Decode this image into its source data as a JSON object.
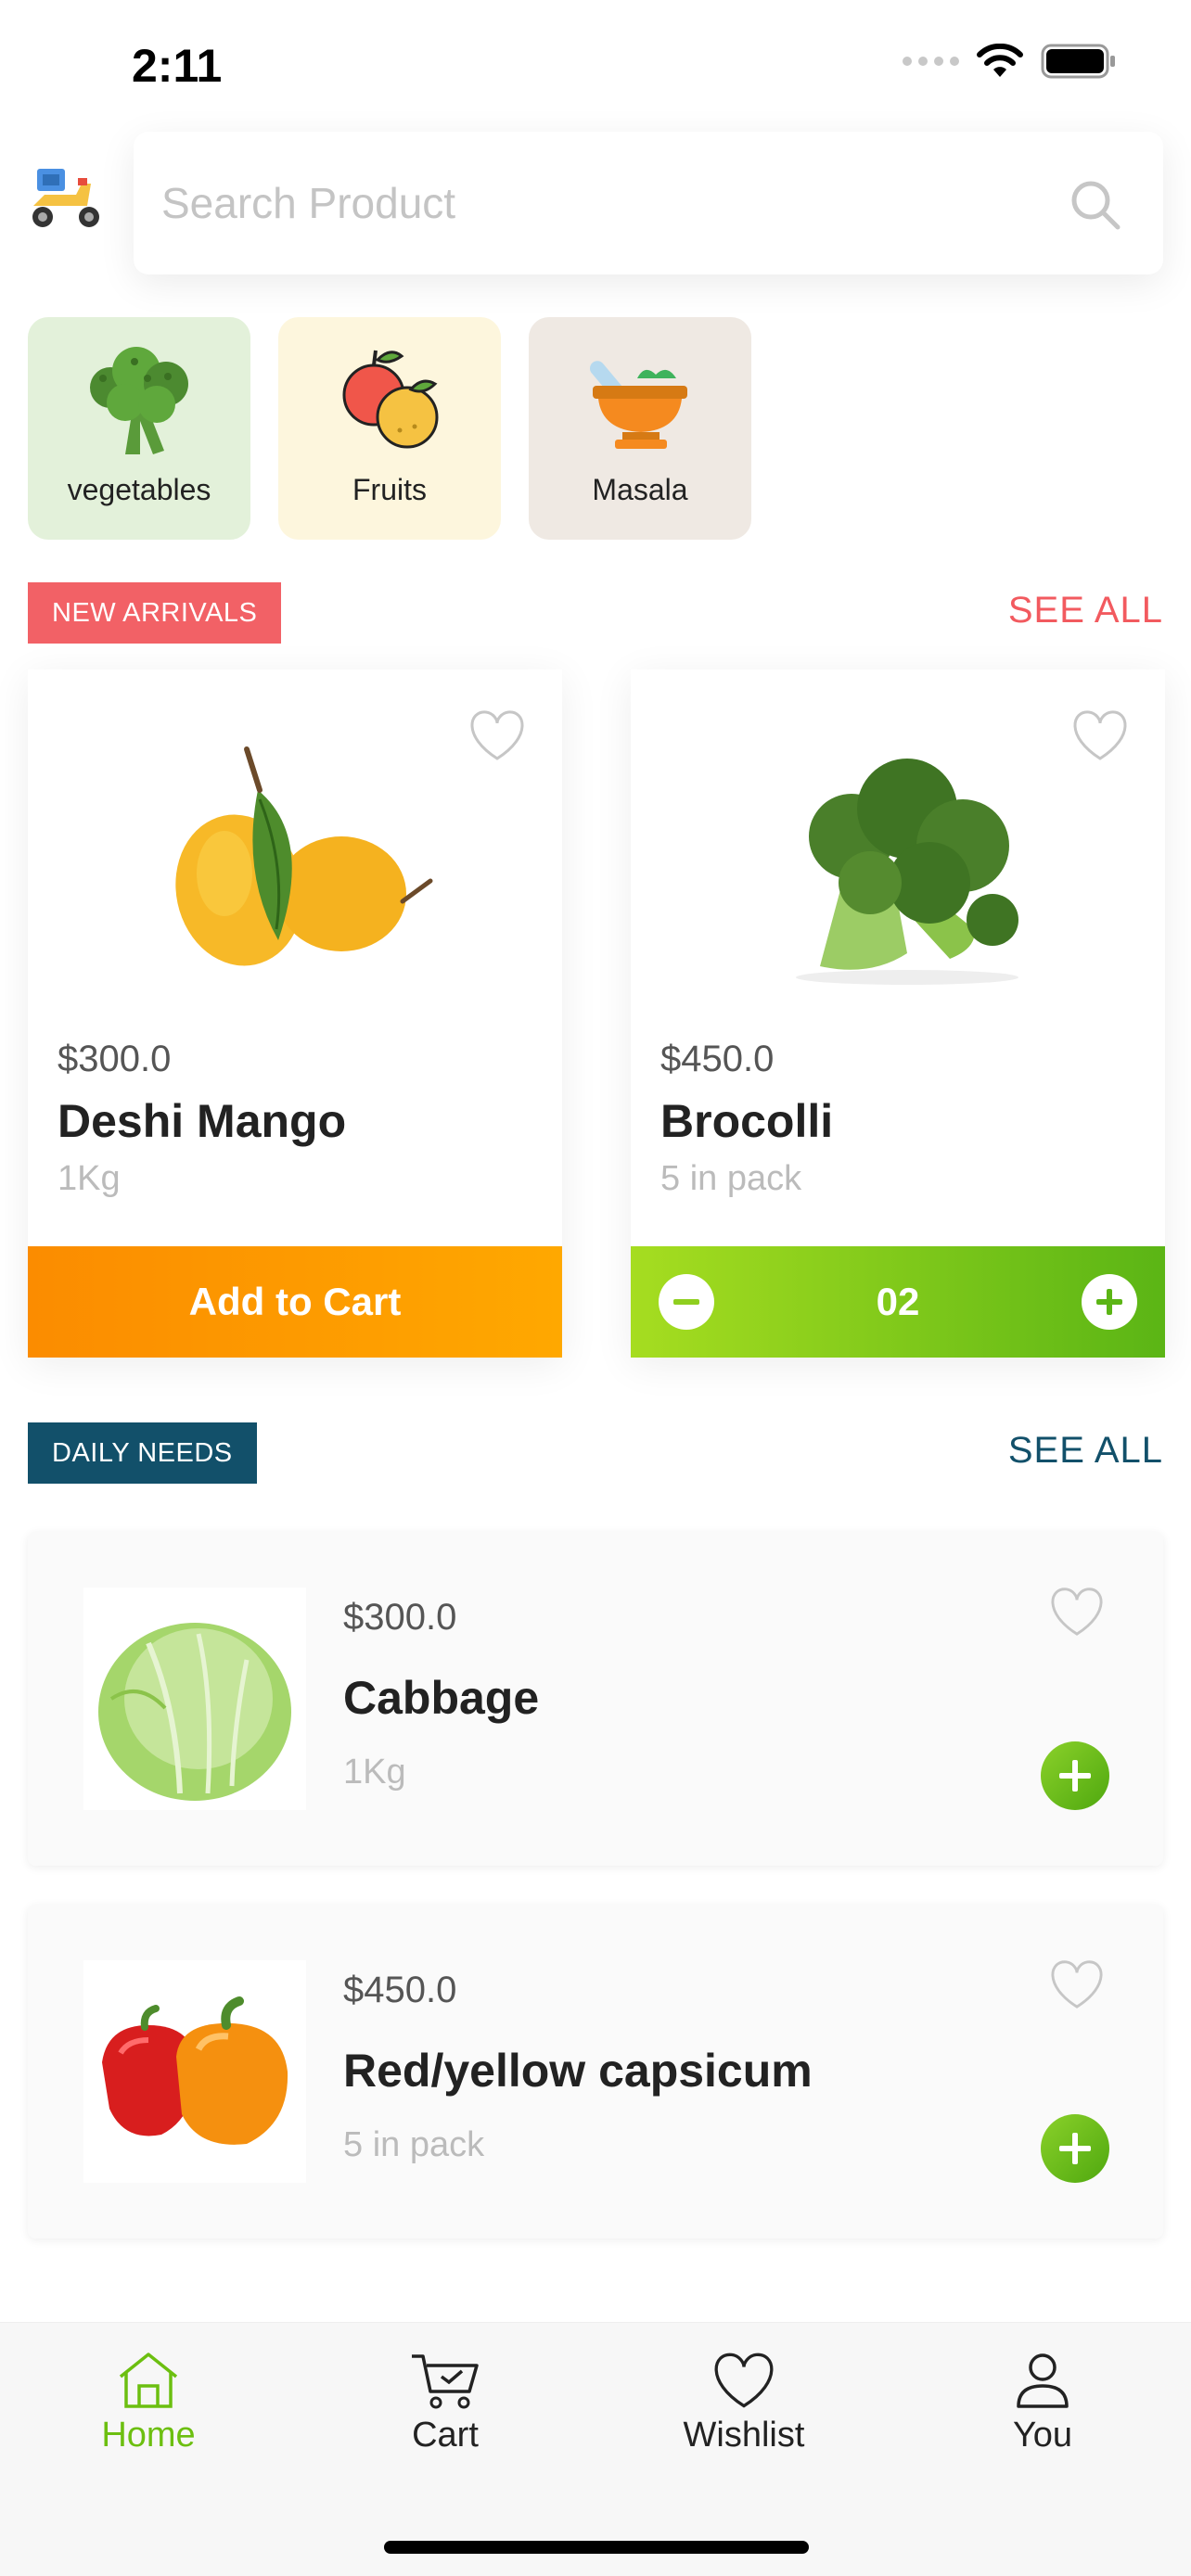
{
  "status_bar": {
    "time": "2:11"
  },
  "search": {
    "placeholder": "Search Product"
  },
  "categories": [
    {
      "label": "vegetables",
      "icon": "broccoli-icon",
      "bg": "#e3f1da"
    },
    {
      "label": "Fruits",
      "icon": "fruits-icon",
      "bg": "#fdf6dd"
    },
    {
      "label": "Masala",
      "icon": "mortar-icon",
      "bg": "#efe9e3"
    }
  ],
  "new_arrivals": {
    "badge": "NEW ARRIVALS",
    "badge_color": "#f26166",
    "see_all": "SEE ALL",
    "products": [
      {
        "price": "$300.0",
        "name": "Deshi Mango",
        "qty": "1Kg",
        "button": "Add to Cart"
      },
      {
        "price": "$450.0",
        "name": "Brocolli",
        "qty": "5 in pack",
        "count": "02"
      }
    ]
  },
  "daily_needs": {
    "badge": "DAILY NEEDS",
    "badge_color": "#12506a",
    "see_all": "SEE ALL",
    "items": [
      {
        "price": "$300.0",
        "name": "Cabbage",
        "qty": "1Kg"
      },
      {
        "price": "$450.0",
        "name": "Red/yellow capsicum",
        "qty": "5 in pack"
      }
    ]
  },
  "nav": {
    "items": [
      {
        "label": "Home",
        "icon": "home-icon",
        "active": true
      },
      {
        "label": "Cart",
        "icon": "cart-icon",
        "active": false
      },
      {
        "label": "Wishlist",
        "icon": "heart-icon",
        "active": false
      },
      {
        "label": "You",
        "icon": "user-icon",
        "active": false
      }
    ],
    "active_color": "#6cbf10"
  }
}
